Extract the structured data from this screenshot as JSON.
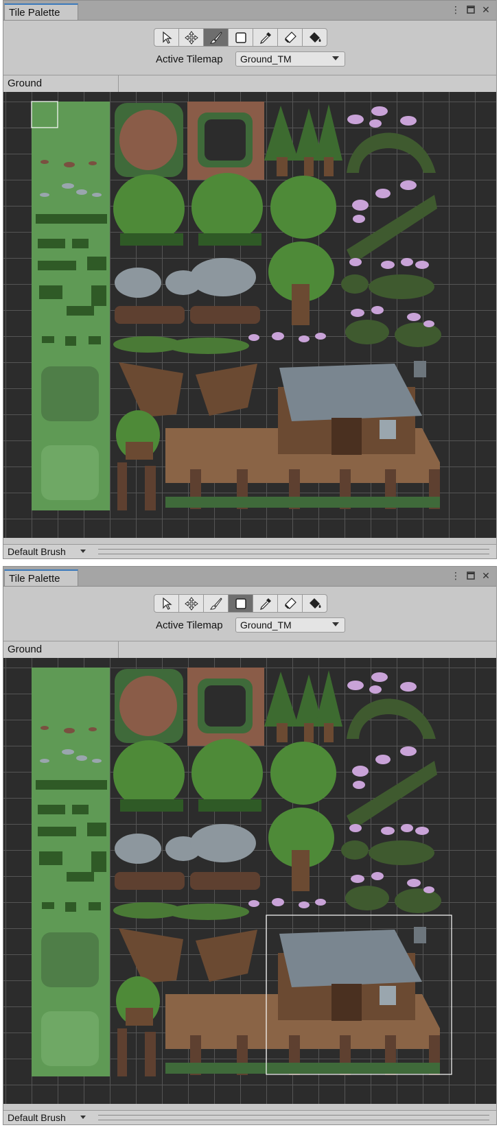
{
  "panels": [
    {
      "tab_label": "Tile Palette",
      "active_tool": "paint",
      "tilemap_label": "Active Tilemap",
      "tilemap_value": "Ground_TM",
      "palette_name": "Ground",
      "brush": "Default Brush",
      "selection": "single-tile"
    },
    {
      "tab_label": "Tile Palette",
      "active_tool": "box-fill",
      "tilemap_label": "Active Tilemap",
      "tilemap_value": "Ground_TM",
      "palette_name": "Ground",
      "brush": "Default Brush",
      "selection": "cabin-region"
    }
  ],
  "tools": [
    "select-icon",
    "move-icon",
    "paint-brush-icon",
    "box-fill-icon",
    "picker-icon",
    "eraser-icon",
    "fill-bucket-icon"
  ],
  "colors": {
    "panel_bg": "#c8c8c8",
    "canvas_bg": "#2c2c2c",
    "grid_line": "#555555",
    "grass": "#5f9a55",
    "dirt": "#8a5c48",
    "wood": "#6b4a32",
    "roof": "#7a8690",
    "accent_tab": "#3a79bb"
  }
}
